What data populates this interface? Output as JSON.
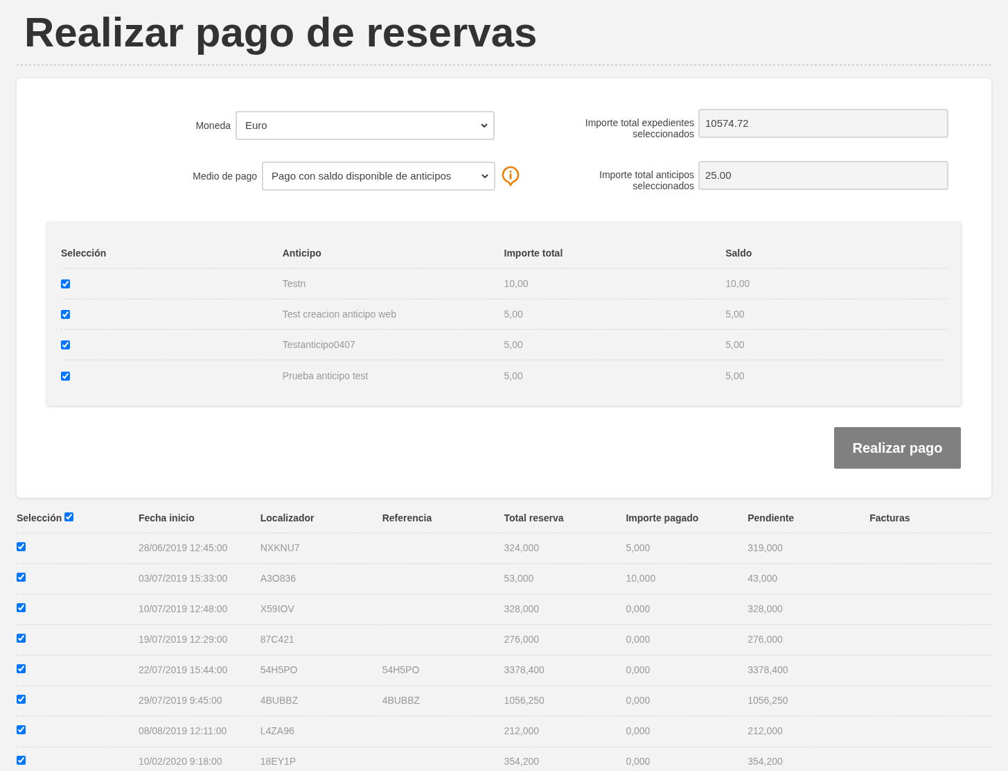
{
  "title": "Realizar pago de reservas",
  "form": {
    "currency": {
      "label": "Moneda",
      "value": "Euro"
    },
    "payment_method": {
      "label": "Medio de pago",
      "value": "Pago con saldo disponible de anticipos"
    },
    "total_bookings": {
      "label": "Importe total expedientes seleccionados",
      "value": "10574.72"
    },
    "total_advances": {
      "label": "Importe total anticipos seleccionados",
      "value": "25.00"
    }
  },
  "advances_table": {
    "columns": [
      "Selección",
      "Anticipo",
      "Importe total",
      "Saldo"
    ],
    "rows": [
      {
        "checked": true,
        "cells": [
          "",
          "Testn",
          "10,00",
          "10,00"
        ]
      },
      {
        "checked": true,
        "cells": [
          "",
          "Test creacion anticipo web",
          "5,00",
          "5,00"
        ]
      },
      {
        "checked": true,
        "cells": [
          "",
          "Testanticipo0407",
          "5,00",
          "5,00"
        ]
      },
      {
        "checked": true,
        "cells": [
          "",
          "Prueba anticipo test",
          "5,00",
          "5,00"
        ]
      }
    ]
  },
  "pay_button": "Realizar pago",
  "bookings_table": {
    "select_all_checked": true,
    "columns": [
      "Selección",
      "Fecha inicio",
      "Localizador",
      "Referencia",
      "Total reserva",
      "Importe pagado",
      "Pendiente",
      "Facturas"
    ],
    "rows": [
      {
        "checked": true,
        "cells": [
          "",
          "28/06/2019 12:45:00",
          "NXKNU7",
          "",
          "324,000",
          "5,000",
          "319,000",
          ""
        ]
      },
      {
        "checked": true,
        "cells": [
          "",
          "03/07/2019 15:33:00",
          "A3O836",
          "",
          "53,000",
          "10,000",
          "43,000",
          ""
        ]
      },
      {
        "checked": true,
        "cells": [
          "",
          "10/07/2019 12:48:00",
          "X59IOV",
          "",
          "328,000",
          "0,000",
          "328,000",
          ""
        ]
      },
      {
        "checked": true,
        "cells": [
          "",
          "19/07/2019 12:29:00",
          "87C421",
          "",
          "276,000",
          "0,000",
          "276,000",
          ""
        ]
      },
      {
        "checked": true,
        "cells": [
          "",
          "22/07/2019 15:44:00",
          "54H5PO",
          "54H5PO",
          "3378,400",
          "0,000",
          "3378,400",
          ""
        ]
      },
      {
        "checked": true,
        "cells": [
          "",
          "29/07/2019 9:45:00",
          "4BUBBZ",
          "4BUBBZ",
          "1056,250",
          "0,000",
          "1056,250",
          ""
        ]
      },
      {
        "checked": true,
        "cells": [
          "",
          "08/08/2019 12:11:00",
          "L4ZA96",
          "",
          "212,000",
          "0,000",
          "212,000",
          ""
        ]
      },
      {
        "checked": true,
        "cells": [
          "",
          "10/02/2020 9:18:00",
          "18EY1P",
          "",
          "354,200",
          "0,000",
          "354,200",
          ""
        ]
      }
    ]
  }
}
